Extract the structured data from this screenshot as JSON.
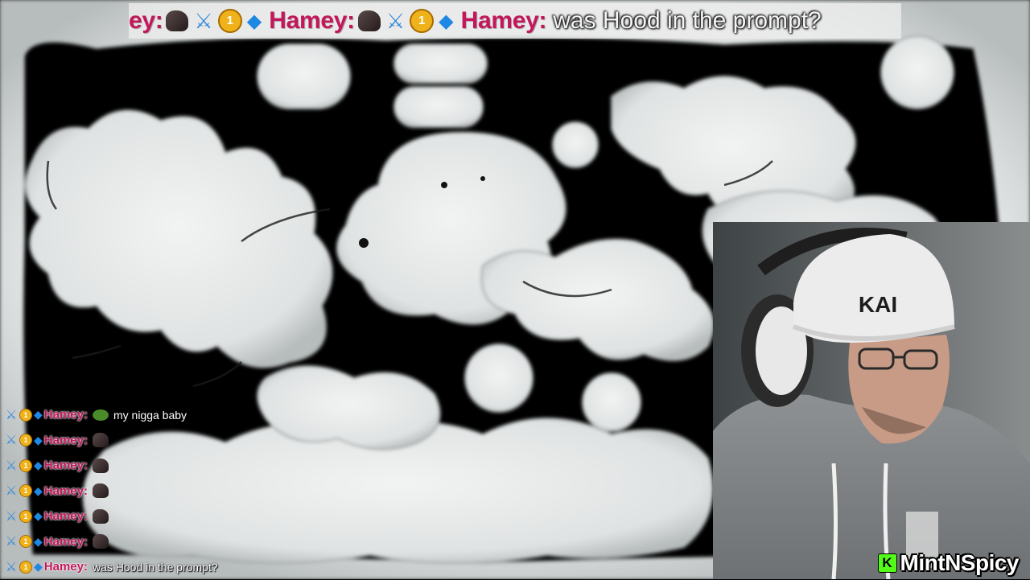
{
  "ticker": {
    "items": [
      {
        "name": "ey:",
        "message": ""
      },
      {
        "name": "Hamey:",
        "message": ""
      },
      {
        "name": "Hamey:",
        "message": "was Hood in the prompt?"
      }
    ],
    "badges": {
      "sword_icon": "sword-icon",
      "coin_label": "1",
      "cube_icon": "cube-icon"
    }
  },
  "chat": {
    "messages": [
      {
        "user": "Hamey:",
        "emote": "frog-emote",
        "text": "my nigga baby"
      },
      {
        "user": "Hamey:",
        "emote": "hood-emote",
        "text": ""
      },
      {
        "user": "Hamey:",
        "emote": "hood-emote",
        "text": ""
      },
      {
        "user": "Hamey:",
        "emote": "hood-emote",
        "text": ""
      },
      {
        "user": "Hamey:",
        "emote": "hood-emote",
        "text": ""
      },
      {
        "user": "Hamey:",
        "emote": "hood-emote",
        "text": ""
      },
      {
        "user": "Hamey:",
        "emote": "",
        "text": "was Hood in the prompt?"
      }
    ],
    "badge_coin_label": "1"
  },
  "webcam": {
    "streamer_name": "MintNSpicy",
    "platform_icon_label": "K",
    "beanie_text": "KAI"
  },
  "colors": {
    "background": "#000000",
    "blob": "#e6e8e8",
    "username": "#c2185b",
    "badge_blue": "#3b8ed8",
    "badge_gold": "#f0b21a",
    "kick_green": "#53fc18"
  }
}
